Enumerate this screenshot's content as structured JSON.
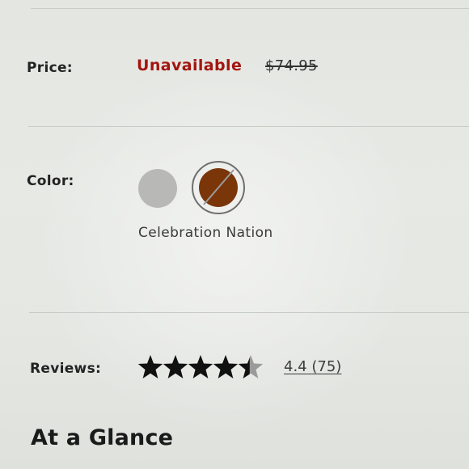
{
  "price": {
    "label": "Price:",
    "status": "Unavailable",
    "original_price": "$74.95"
  },
  "color": {
    "label": "Color:",
    "swatches": [
      {
        "name": "gray-swatch",
        "color": "#b8b9b7",
        "selected": false
      },
      {
        "name": "Celebration Nation",
        "color": "#7a3509",
        "selected": true,
        "unavailable": true
      }
    ],
    "selected_name": "Celebration Nation"
  },
  "reviews": {
    "label": "Reviews:",
    "rating": "4.4",
    "count": "(75)",
    "stars_max": 5
  },
  "section": {
    "title": "At a Glance"
  },
  "colors": {
    "unavailable": "#a3150f",
    "star_fill": "#111111",
    "star_empty": "#9a9a9a"
  }
}
